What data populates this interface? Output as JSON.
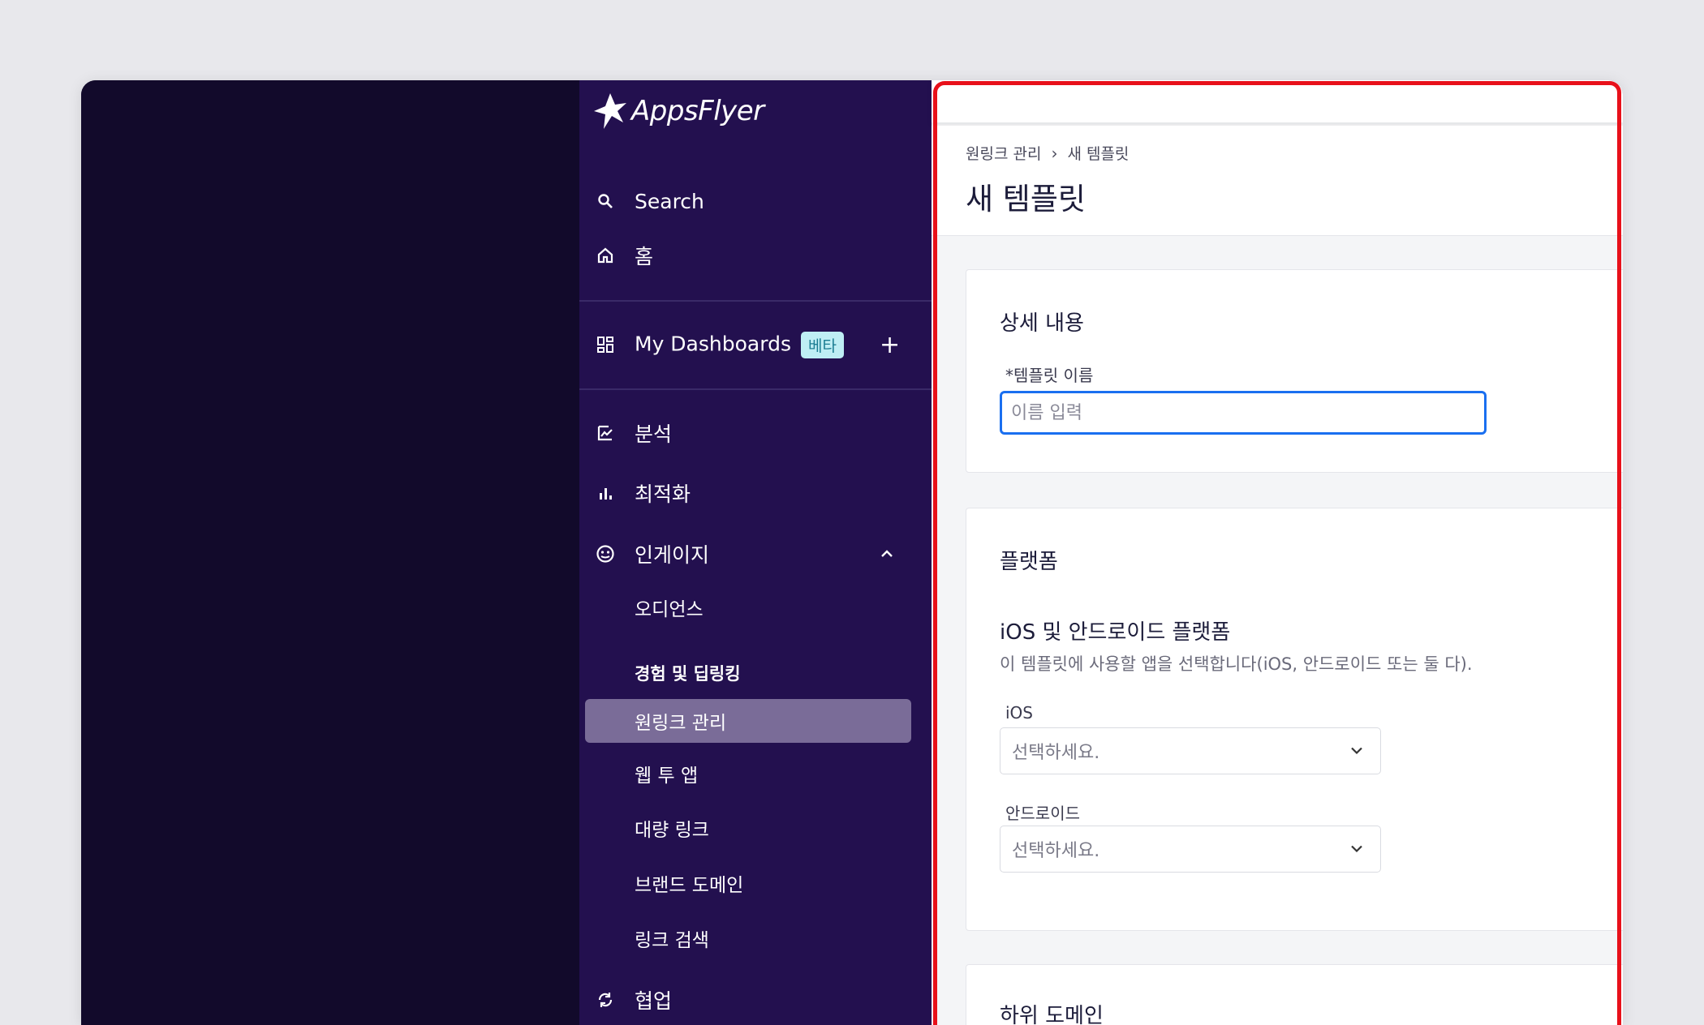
{
  "brand": {
    "name": "AppsFlyer"
  },
  "sidebar": {
    "search_label": "Search",
    "home_label": "홈",
    "dashboards_label": "My Dashboards",
    "dashboards_badge": "베타",
    "add_label": "+",
    "analysis_label": "분석",
    "optimize_label": "최적화",
    "engage_label": "인게이지",
    "engage_items": {
      "audience": "오디언스",
      "experience_header": "경험 및 딥링킹",
      "onelink": "원링크 관리",
      "web_to_app": "웹 투 앱",
      "bulk_links": "대량 링크",
      "brand_domain": "브랜드 도메인",
      "link_search": "링크 검색"
    },
    "collab_label": "협업"
  },
  "header": {
    "breadcrumb_parent": "원링크 관리",
    "breadcrumb_sep": "›",
    "breadcrumb_current": "새 템플릿",
    "title": "새 템플릿"
  },
  "details": {
    "title": "상세 내용",
    "name_label": "*템플릿 이름",
    "name_placeholder": "이름 입력",
    "name_value": ""
  },
  "platform": {
    "title": "플랫폼",
    "subtitle": "iOS 및 안드로이드 플랫폼",
    "description": "이 템플릿에 사용할 앱을 선택합니다(iOS, 안드로이드 또는 둘 다).",
    "ios_label": "iOS",
    "ios_value": "선택하세요.",
    "android_label": "안드로이드",
    "android_value": "선택하세요."
  },
  "subdomain": {
    "title": "하위 도메인"
  },
  "colors": {
    "sidebar": "#23104f",
    "active": "#7a6c98",
    "accent": "#1a6ff0",
    "highlight": "#e8101a"
  }
}
